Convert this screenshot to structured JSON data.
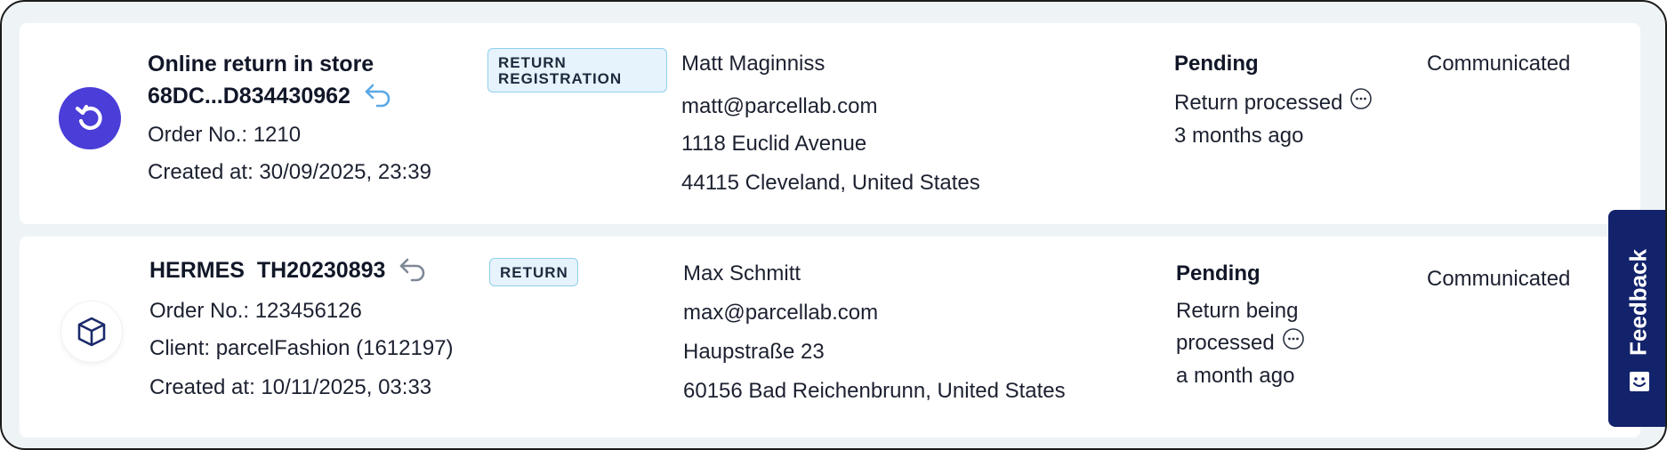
{
  "rows": [
    {
      "type_icon": "return-circle-icon",
      "title_line1": "Online return in store",
      "title_line2": "68DC...D834430962",
      "badge": "RETURN REGISTRATION",
      "badge_line1": "RETURN",
      "badge_line2": "REGISTRATION",
      "meta": [
        "Order No.: 1210",
        "Created at: 30/09/2025, 23:39"
      ],
      "customer": {
        "name": "Matt Maginniss",
        "email": "matt@parcellab.com",
        "street": "1118 Euclid Avenue",
        "city": "44115 Cleveland, United States"
      },
      "status": {
        "title": "Pending",
        "detail": "Return processed",
        "time": "3 months ago"
      },
      "communication": "Communicated"
    },
    {
      "type_icon": "package-icon",
      "title_line1": "HERMES  TH20230893",
      "badge": "RETURN",
      "meta": [
        "Order No.: 123456126",
        "Client: parcelFashion (1612197)",
        "Created at: 10/11/2025, 03:33"
      ],
      "customer": {
        "name": "Max Schmitt",
        "email": "max@parcellab.com",
        "street": "Haupstraße 23",
        "city": "60156 Bad Reichenbrunn, United States"
      },
      "status": {
        "title": "Pending",
        "detail_line1": "Return being",
        "detail_line2": "processed",
        "time": "a month ago"
      },
      "communication": "Communicated"
    }
  ],
  "feedback": {
    "label": "Feedback",
    "icon": "smiley-icon"
  },
  "colors": {
    "accent": "#4a3dd8",
    "badge_border": "#8fd0ef",
    "badge_bg": "#e6f2fc",
    "feedback_bg": "#13236b",
    "return_arrow": "#5aa8e6",
    "return_arrow_gray": "#7e8896"
  }
}
